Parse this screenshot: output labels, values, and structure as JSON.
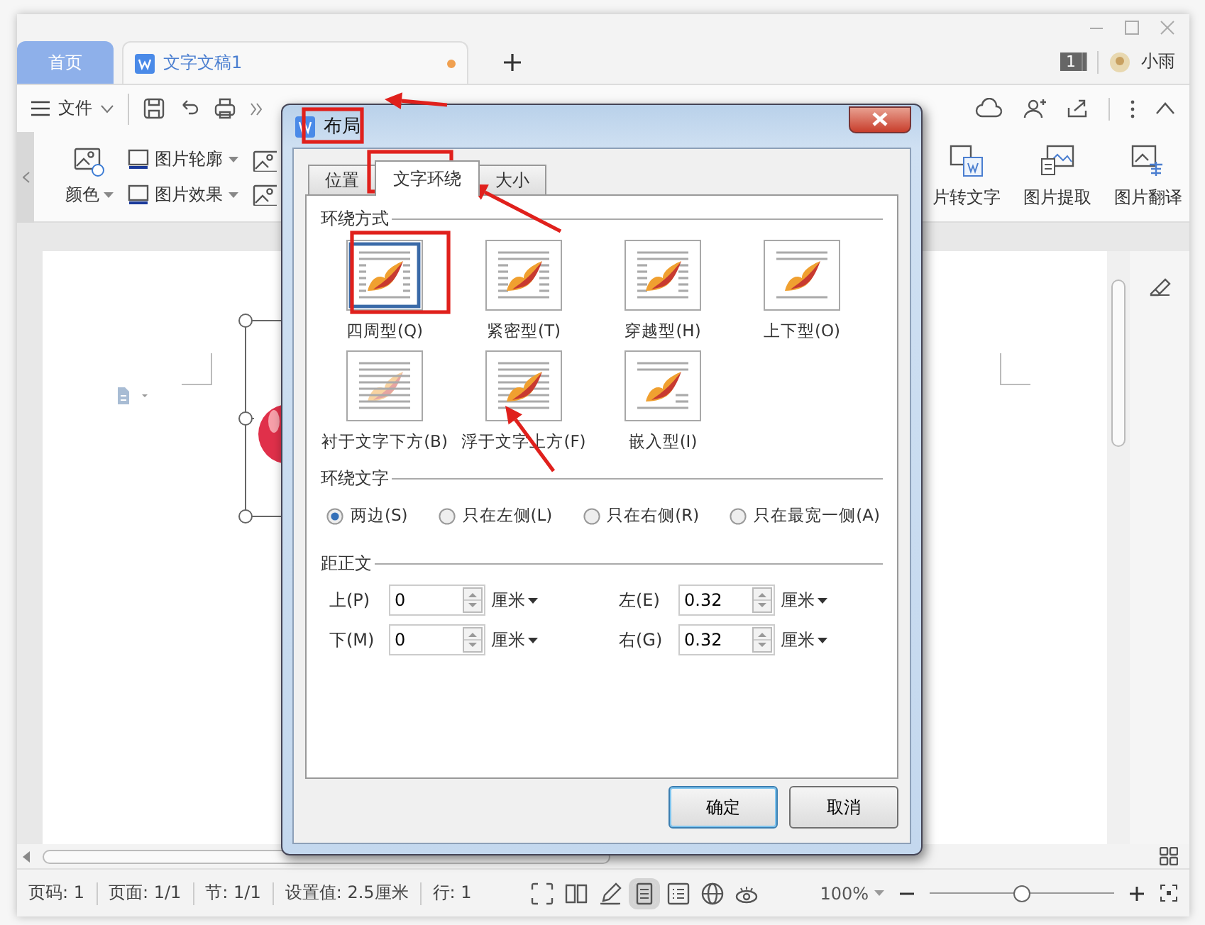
{
  "tabs": [
    {
      "label": "首页",
      "kind": "home",
      "selected": false,
      "unsaved": false
    },
    {
      "label": "文字文稿1",
      "kind": "document",
      "selected": true,
      "unsaved": true
    }
  ],
  "account": {
    "badge": "1",
    "user": "小雨"
  },
  "menu": {
    "label": "文件"
  },
  "ribbon_left": [
    {
      "label": "颜色",
      "kind": "large"
    },
    {
      "label": "图片轮廓",
      "kind": "small"
    },
    {
      "label": "图片效果",
      "kind": "small"
    }
  ],
  "ribbon_right": [
    {
      "label": "片转文字",
      "kind": "to-text"
    },
    {
      "label": "图片提取",
      "kind": "extract"
    },
    {
      "label": "图片翻译",
      "kind": "translate"
    }
  ],
  "dialog": {
    "title": "布局",
    "tabs": [
      {
        "label": "位置",
        "selected": false
      },
      {
        "label": "文字环绕",
        "selected": true
      },
      {
        "label": "大小",
        "selected": false
      }
    ],
    "wrap_group": "环绕方式",
    "wrap_styles": [
      {
        "label": "四周型(Q)",
        "kind": "square",
        "selected": true
      },
      {
        "label": "紧密型(T)",
        "kind": "tight",
        "selected": false
      },
      {
        "label": "穿越型(H)",
        "kind": "through",
        "selected": false
      },
      {
        "label": "上下型(O)",
        "kind": "topbottom",
        "selected": false
      },
      {
        "label": "衬于文字下方(B)",
        "kind": "behind",
        "selected": false
      },
      {
        "label": "浮于文字上方(F)",
        "kind": "front",
        "selected": false
      },
      {
        "label": "嵌入型(I)",
        "kind": "inline",
        "selected": false
      }
    ],
    "wrap_text_group": "环绕文字",
    "wrap_sides": [
      {
        "label": "两边(S)",
        "selected": true
      },
      {
        "label": "只在左侧(L)",
        "selected": false
      },
      {
        "label": "只在右侧(R)",
        "selected": false
      },
      {
        "label": "只在最宽一侧(A)",
        "selected": false
      }
    ],
    "distance_group": "距正文",
    "distances": [
      {
        "label": "上(P)",
        "value": "0",
        "unit": "厘米"
      },
      {
        "label": "左(E)",
        "value": "0.32",
        "unit": "厘米"
      },
      {
        "label": "下(M)",
        "value": "0",
        "unit": "厘米"
      },
      {
        "label": "右(G)",
        "value": "0.32",
        "unit": "厘米"
      }
    ],
    "buttons": [
      {
        "label": "确定",
        "kind": "default"
      },
      {
        "label": "取消",
        "kind": "normal"
      }
    ]
  },
  "status_bar": {
    "items": [
      "页码: 1",
      "页面: 1/1",
      "节: 1/1",
      "设置值: 2.5厘米",
      "行: 1"
    ],
    "view_modes": [
      {
        "kind": "fullscreen",
        "selected": false
      },
      {
        "kind": "reading",
        "selected": false
      },
      {
        "kind": "writing",
        "selected": false
      },
      {
        "kind": "page",
        "selected": true
      },
      {
        "kind": "outline",
        "selected": false
      },
      {
        "kind": "web",
        "selected": false
      },
      {
        "kind": "eye",
        "selected": false
      }
    ],
    "zoom": "100%",
    "zoom_slider": {
      "level": 0.5
    }
  }
}
